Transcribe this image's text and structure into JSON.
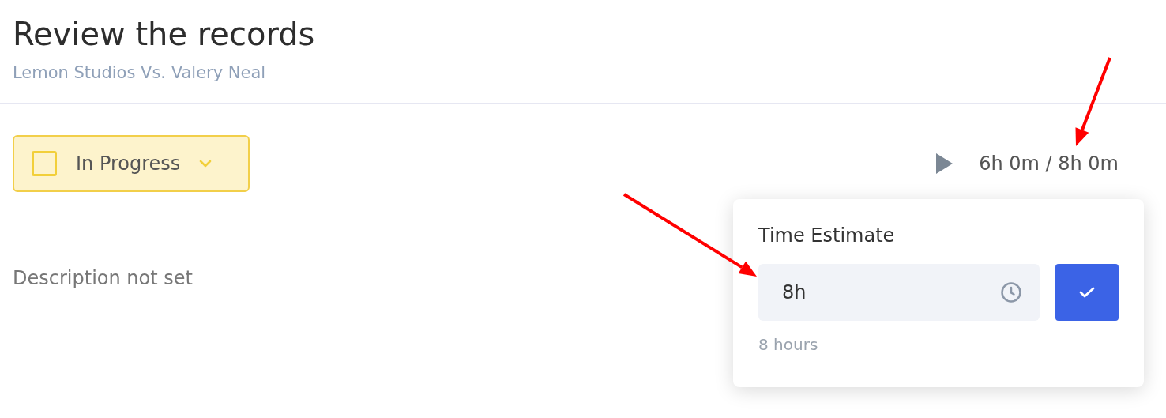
{
  "header": {
    "title": "Review the records",
    "subtitle": "Lemon Studios Vs. Valery Neal"
  },
  "status": {
    "label": "In Progress",
    "checked": false
  },
  "timer": {
    "playing": false,
    "reading": "6h 0m / 8h 0m"
  },
  "description": {
    "placeholder": "Description not set"
  },
  "popover": {
    "title": "Time Estimate",
    "value": "8h",
    "hint": "8 hours"
  },
  "annotations": [
    {
      "kind": "arrow"
    },
    {
      "kind": "arrow"
    }
  ]
}
